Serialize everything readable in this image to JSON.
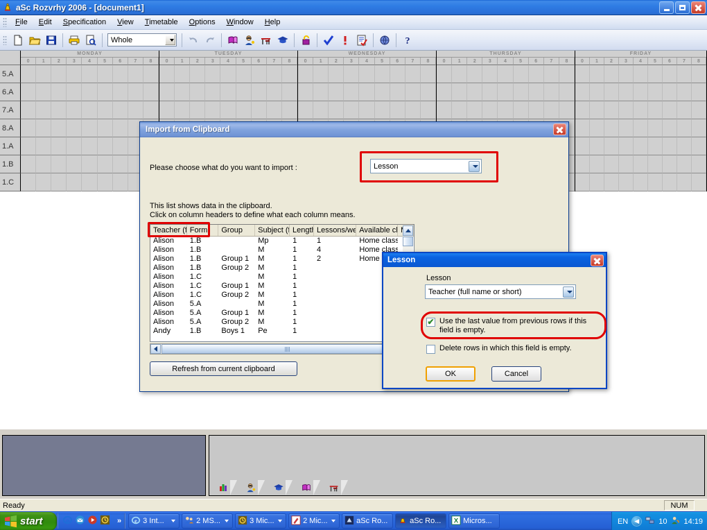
{
  "window": {
    "title": "aSc Rozvrhy 2006  - [document1]",
    "icon": "app-bell-icon",
    "controls": {
      "minimize": "Minimize",
      "restore": "Restore",
      "close": "Close"
    }
  },
  "menu": {
    "items": [
      {
        "label": "File",
        "accel": "F"
      },
      {
        "label": "Edit",
        "accel": "E"
      },
      {
        "label": "Specification",
        "accel": "S"
      },
      {
        "label": "View",
        "accel": "V"
      },
      {
        "label": "Timetable",
        "accel": "T"
      },
      {
        "label": "Options",
        "accel": "O"
      },
      {
        "label": "Window",
        "accel": "W"
      },
      {
        "label": "Help",
        "accel": "H"
      }
    ]
  },
  "toolbar": {
    "view_combo_value": "Whole",
    "buttons": [
      "new-document-icon",
      "open-folder-icon",
      "save-disk-icon",
      "print-icon",
      "print-preview-icon",
      "undo-icon",
      "redo-icon",
      "subjects-book-icon",
      "teachers-icon",
      "classrooms-desk-icon",
      "classes-cap-icon",
      "lock-icon",
      "verify-check-icon",
      "warning-icon",
      "report-icon",
      "globe-icon",
      "help-question-icon"
    ]
  },
  "timetable": {
    "days": [
      "MONDAY",
      "TUESDAY",
      "WEDNESDAY",
      "THURSDAY",
      "FRIDAY"
    ],
    "periods": [
      "0",
      "1",
      "2",
      "3",
      "4",
      "5",
      "6",
      "7",
      "8"
    ],
    "rows": [
      "5.A",
      "6.A",
      "7.A",
      "8.A",
      "1.A",
      "1.B",
      "1.C"
    ]
  },
  "bottom_panel": {
    "tabs": [
      "chart-icon",
      "teachers-icon",
      "classes-cap-icon",
      "subjects-book-icon",
      "classrooms-desk-icon"
    ]
  },
  "statusbar": {
    "message": "Ready",
    "num_lock": "NUM"
  },
  "taskbar": {
    "start_label": "start",
    "quick_launch": [
      "internet-explorer-icon",
      "outlook-express-icon",
      "media-player-icon",
      "asc-timetable-icon"
    ],
    "chevrons": "»",
    "buttons": [
      {
        "label": "3 Int...",
        "icon": "internet-explorer-icon",
        "has_caret": true,
        "active": false
      },
      {
        "label": "2 MS...",
        "icon": "msn-people-icon",
        "has_caret": true,
        "active": false
      },
      {
        "label": "3 Mic...",
        "icon": "asc-timetable-icon",
        "has_caret": true,
        "active": false
      },
      {
        "label": "2 Mic...",
        "icon": "paint-icon",
        "has_caret": true,
        "active": false
      },
      {
        "label": "aSc Ro...",
        "icon": "asc-blue-icon",
        "has_caret": false,
        "active": false
      },
      {
        "label": "aSc Ro...",
        "icon": "app-bell-icon",
        "has_caret": false,
        "active": true
      },
      {
        "label": "Micros...",
        "icon": "excel-icon",
        "has_caret": false,
        "active": false
      }
    ],
    "tray": {
      "language": "EN",
      "network_count": "10",
      "clock": "14:19"
    }
  },
  "import_dialog": {
    "title": "Import from Clipboard",
    "prompt": "Please choose what do you want to import :",
    "import_type": "Lesson",
    "info_line1": "This list shows data in the clipboard.",
    "info_line2": "Click on column headers to define what each column means.",
    "columns": [
      "Teacher (full...",
      "Form",
      "Group",
      "Subject (full ...",
      "Length",
      "Lessons/we...",
      "Available cl...",
      "M"
    ],
    "rows": [
      [
        "Alison",
        "1.B",
        "",
        "Mp",
        "1",
        "1",
        "Home class...",
        ""
      ],
      [
        "Alison",
        "1.B",
        "",
        "M",
        "1",
        "4",
        "Home class...",
        ""
      ],
      [
        "Alison",
        "1.B",
        "Group 1",
        "M",
        "1",
        "2",
        "Home class...",
        ""
      ],
      [
        "Alison",
        "1.B",
        "Group 2",
        "M",
        "1",
        "",
        "",
        ""
      ],
      [
        "Alison",
        "1.C",
        "",
        "M",
        "1",
        "",
        "",
        ""
      ],
      [
        "Alison",
        "1.C",
        "Group 1",
        "M",
        "1",
        "",
        "",
        ""
      ],
      [
        "Alison",
        "1.C",
        "Group 2",
        "M",
        "1",
        "",
        "",
        ""
      ],
      [
        "Alison",
        "5.A",
        "",
        "M",
        "1",
        "",
        "",
        ""
      ],
      [
        "Alison",
        "5.A",
        "Group 1",
        "M",
        "1",
        "",
        "",
        ""
      ],
      [
        "Alison",
        "5.A",
        "Group 2",
        "M",
        "1",
        "",
        "",
        ""
      ],
      [
        "Andy",
        "1.B",
        "Boys 1",
        "Pe",
        "1",
        "",
        "",
        ""
      ]
    ],
    "refresh_button": "Refresh from current clipboard"
  },
  "lesson_dialog": {
    "title": "Lesson",
    "field_label": "Lesson",
    "field_value": "Teacher (full name or short)",
    "checkbox_use_last": {
      "label": "Use the last value from previous rows if this field is empty.",
      "checked": true
    },
    "checkbox_delete_empty": {
      "label": "Delete rows in which this field is empty.",
      "checked": false
    },
    "ok_button": "OK",
    "cancel_button": "Cancel"
  },
  "highlights": {
    "color": "#e00000"
  }
}
